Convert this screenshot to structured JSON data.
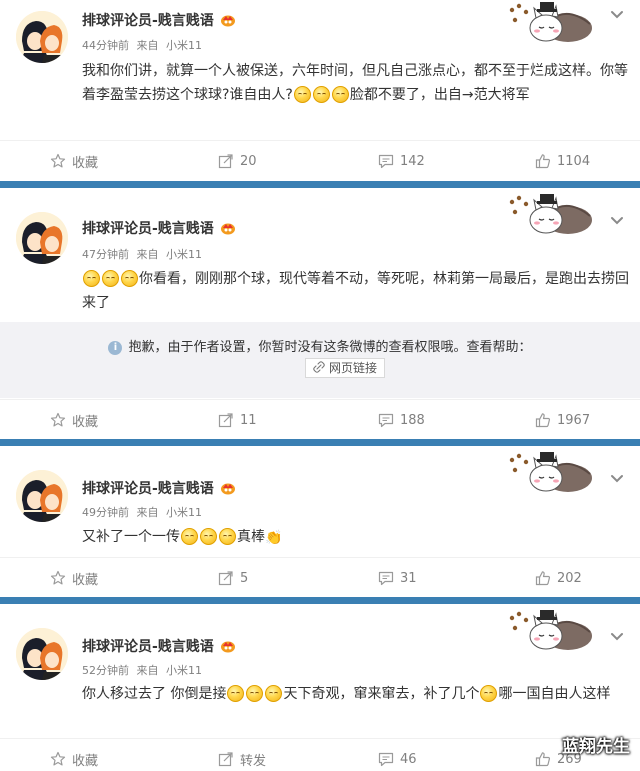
{
  "posts": [
    {
      "username": "排球评论员-贱言贱语",
      "time": "44分钟前",
      "source_prefix": "来自",
      "source": "小米11",
      "text_before": "我和你们讲，就算一个人被保送，六年时间，但凡自己涨点心，都不至于烂成这样。你等着李盈莹去捞这个球球?谁自由人?",
      "text_after": "脸都不要了，出自→范大将军",
      "actions": {
        "favorite": "收藏",
        "repost": "20",
        "comment": "142",
        "like": "1104"
      }
    },
    {
      "username": "排球评论员-贱言贱语",
      "time": "47分钟前",
      "source_prefix": "来自",
      "source": "小米11",
      "text_after": "你看看，刚刚那个球，现代等着不动，等死呢，林莉第一局最后，是跑出去捞回来了",
      "notice": "抱歉，由于作者设置，你暂时没有这条微博的查看权限哦。查看帮助：",
      "link_label": "网页链接",
      "actions": {
        "favorite": "收藏",
        "repost": "11",
        "comment": "188",
        "like": "1967"
      }
    },
    {
      "username": "排球评论员-贱言贱语",
      "time": "49分钟前",
      "source_prefix": "来自",
      "source": "小米11",
      "text_before": "又补了一个一传",
      "text_after": "真棒",
      "actions": {
        "favorite": "收藏",
        "repost": "5",
        "comment": "31",
        "like": "202"
      }
    },
    {
      "username": "排球评论员-贱言贱语",
      "time": "52分钟前",
      "source_prefix": "来自",
      "source": "小米11",
      "text_before": "你人移过去了 你倒是接",
      "text_middle": "天下奇观，窜来窜去，补了几个",
      "text_after": "哪一国自由人这样",
      "actions": {
        "favorite": "收藏",
        "repost": "转发",
        "comment": "46",
        "like": "269"
      }
    }
  ],
  "watermark": "蓝翔先生",
  "colors": {
    "separator": "#3a7fb3",
    "meta": "#808080",
    "notice_bg": "#f2f2f5"
  },
  "icons": [
    "avatar-anime-icon",
    "vip-badge-icon",
    "cat-sticker-icon",
    "chevron-down-icon",
    "star-icon",
    "repost-icon",
    "comment-icon",
    "like-icon",
    "info-icon",
    "link-icon",
    "smile-emoji-icon",
    "clap-emoji-icon"
  ]
}
